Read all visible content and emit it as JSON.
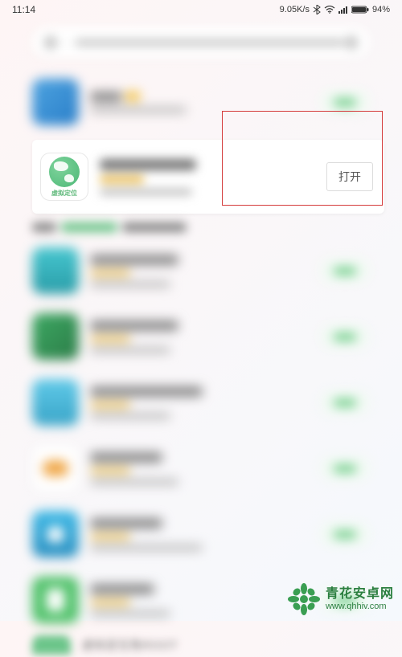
{
  "status": {
    "time": "11:14",
    "speed": "9.05K/s",
    "battery_pct": "94%"
  },
  "featured": {
    "icon_label": "虚拟定位",
    "open_button": "打开"
  },
  "bottom_row": {
    "text": "虚拟定位免ROOT"
  },
  "watermark": {
    "title": "青花安卓网",
    "url": "www.qhhiv.com"
  }
}
